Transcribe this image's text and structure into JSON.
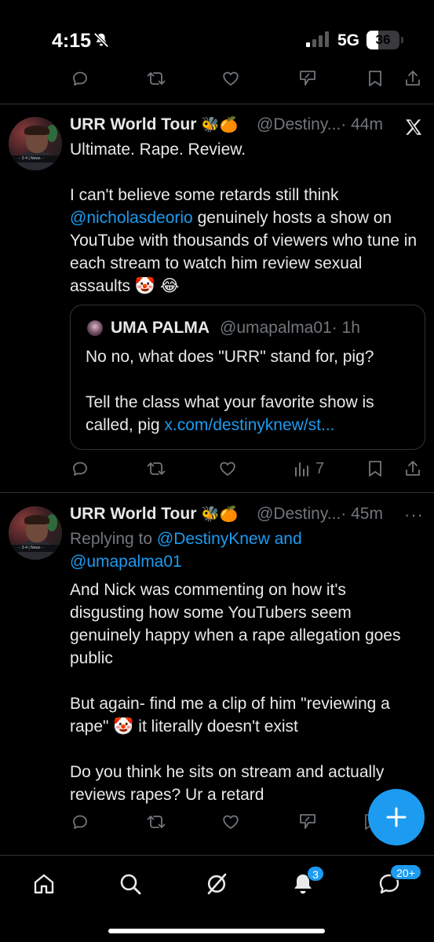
{
  "status_bar": {
    "time": "4:15",
    "network": "5G",
    "battery": "36",
    "battery_level_percent": 36
  },
  "tweets": [
    {
      "author_name": "URR World Tour",
      "author_emojis": "🐝🍊",
      "handle": "@Destiny...",
      "time": "· 44m",
      "text_before_mention": "Ultimate. Rape. Review.\n\nI can't believe some retards still think ",
      "mention": "@nicholasdeorio",
      "text_after_mention": " genuinely hosts a show on YouTube with thousands of viewers who tune in each stream to watch him review sexual assaults 🤡 😂",
      "quote": {
        "author_name": "UMA PALMA",
        "handle": "@umapalma01",
        "time": "· 1h",
        "text": "No no, what does \"URR\" stand for, pig?\n\nTell the class what your favorite show is called, pig ",
        "link": "x.com/destinyknew/st..."
      },
      "views": "7"
    },
    {
      "author_name": "URR World Tour",
      "author_emojis": "🐝🍊",
      "handle": "@Destiny...",
      "time": "· 45m",
      "replying_prefix": "Replying to ",
      "replying_user1": "@DestinyKnew",
      "replying_and": " and",
      "replying_user2": "@umapalma01",
      "text": "And Nick was commenting on how it's disgusting how some YouTubers seem genuinely happy when a rape allegation goes public\n\nBut again- find me a clip of him \"reviewing a rape\" 🤡 it literally doesn't exist\n\nDo you think he sits on stream and actually reviews rapes? Ur a retard"
    }
  ],
  "nav": {
    "notifications_badge": "3",
    "messages_badge": "20+"
  },
  "icons": {
    "reply": "reply-icon",
    "retweet": "retweet-icon",
    "like": "heart-icon",
    "views": "views-icon",
    "grok": "grok-icon",
    "bookmark": "bookmark-icon",
    "share": "share-icon",
    "x_logo": "x-logo-icon",
    "compose": "plus-icon"
  },
  "colors": {
    "background": "#000000",
    "text": "#e7e9ea",
    "muted": "#71767b",
    "accent": "#1d9bf0",
    "divider": "#2f3336"
  }
}
